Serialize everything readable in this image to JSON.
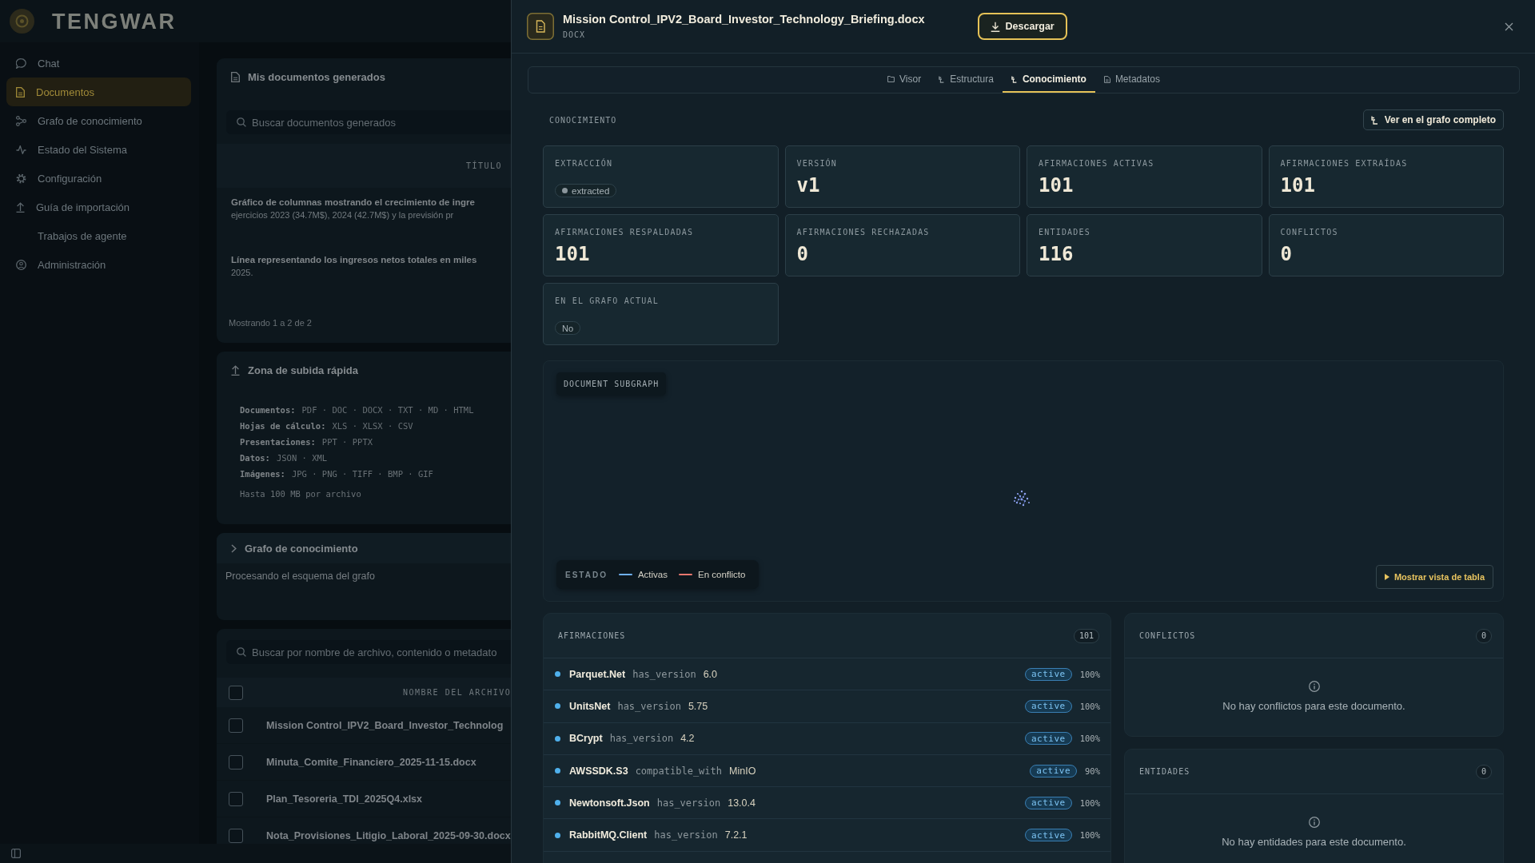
{
  "backdrop": {
    "logo": "TENGWAR",
    "nav": [
      {
        "label": "Chat",
        "selected": false
      },
      {
        "label": "Documentos",
        "selected": true
      },
      {
        "label": "Grafo de conocimiento",
        "selected": false
      },
      {
        "label": "Estado del Sistema",
        "selected": false
      },
      {
        "label": "Configuración",
        "selected": false
      },
      {
        "label": "Guía de importación",
        "selected": false
      },
      {
        "label": "Trabajos de agente",
        "selected": false
      },
      {
        "label": "Administración",
        "selected": false
      }
    ],
    "generated_documents": {
      "title": "Mis documentos generados",
      "search": {
        "placeholder": "Buscar documentos generados"
      },
      "column": "TÍTULO",
      "rows": [
        [
          "Gráfico de columnas mostrando el crecimiento de ingre",
          "ejercicios 2023 (34.7M$), 2024 (42.7M$) y la previsión pr"
        ],
        [
          "Línea representando los ingresos netos totales en miles",
          "2025."
        ]
      ],
      "footer": "Mostrando 1 a 2 de 2"
    },
    "upload_zone": {
      "title": "Zona de subida rápida",
      "formats": [
        {
          "label": "Documentos:",
          "values": "PDF · DOC · DOCX · TXT · MD · HTML"
        },
        {
          "label": "Hojas de cálculo:",
          "values": "XLS · XLSX · CSV"
        },
        {
          "label": "Presentaciones:",
          "values": "PPT · PPTX"
        },
        {
          "label": "Datos:",
          "values": "JSON · XML"
        },
        {
          "label": "Imágenes:",
          "values": "JPG · PNG · TIFF · BMP · GIF"
        }
      ],
      "limit": "Hasta 100 MB por archivo"
    },
    "knowledge_graph": {
      "title": "Grafo de conocimiento",
      "status": "Procesando el esquema del grafo"
    },
    "files": {
      "search": {
        "placeholder": "Buscar por nombre de archivo, contenido o metadato"
      },
      "select_all": {
        "checked": false
      },
      "column": "NOMBRE DEL ARCHIVO",
      "rows": [
        {
          "name": "Mission Control_IPV2_Board_Investor_Technolog",
          "checked": false
        },
        {
          "name": "Minuta_Comite_Financiero_2025-11-15.docx",
          "checked": false
        },
        {
          "name": "Plan_Tesoreria_TDI_2025Q4.xlsx",
          "checked": false
        },
        {
          "name": "Nota_Provisiones_Litigio_Laboral_2025-09-30.docx",
          "checked": false
        }
      ]
    }
  },
  "panel": {
    "file": {
      "name": "Mission Control_IPV2_Board_Investor_Technology_Briefing.docx",
      "type": "DOCX"
    },
    "download": "Descargar",
    "tabs": [
      {
        "label": "Visor",
        "selected": false
      },
      {
        "label": "Estructura",
        "selected": false
      },
      {
        "label": "Conocimiento",
        "selected": true
      },
      {
        "label": "Metadatos",
        "selected": false
      }
    ],
    "knowledge": {
      "title": "CONOCIMIENTO",
      "graph_button": "Ver en el grafo completo",
      "stats": [
        {
          "label": "EXTRACCIÓN",
          "kind": "badge",
          "value": "extracted"
        },
        {
          "label": "VERSIÓN",
          "kind": "number",
          "value": "v1"
        },
        {
          "label": "AFIRMACIONES ACTIVAS",
          "kind": "number",
          "value": "101"
        },
        {
          "label": "AFIRMACIONES EXTRAÍDAS",
          "kind": "number",
          "value": "101"
        },
        {
          "label": "AFIRMACIONES RESPALDADAS",
          "kind": "number",
          "value": "101"
        },
        {
          "label": "AFIRMACIONES RECHAZADAS",
          "kind": "number",
          "value": "0"
        },
        {
          "label": "ENTIDADES",
          "kind": "number",
          "value": "116"
        },
        {
          "label": "CONFLICTOS",
          "kind": "number",
          "value": "0"
        },
        {
          "label": "EN EL GRAFO ACTUAL",
          "kind": "pill",
          "value": "No"
        }
      ],
      "subgraph": {
        "title": "DOCUMENT SUBGRAPH",
        "legend": {
          "title": "ESTADO",
          "items": [
            {
              "label": "Activas",
              "color": "#6fb0f0"
            },
            {
              "label": "En conflicto",
              "color": "#e8776e"
            }
          ]
        },
        "table_button": "Mostrar vista de tabla"
      },
      "claims": {
        "title": "AFIRMACIONES",
        "count": "101",
        "rows": [
          {
            "subject": "Parquet.Net",
            "predicate": "has_version",
            "object": "6.0",
            "status": "active",
            "confidence": "100%"
          },
          {
            "subject": "UnitsNet",
            "predicate": "has_version",
            "object": "5.75",
            "status": "active",
            "confidence": "100%"
          },
          {
            "subject": "BCrypt",
            "predicate": "has_version",
            "object": "4.2",
            "status": "active",
            "confidence": "100%"
          },
          {
            "subject": "AWSSDK.S3",
            "predicate": "compatible_with",
            "object": "MinIO",
            "status": "active",
            "confidence": "90%"
          },
          {
            "subject": "Newtonsoft.Json",
            "predicate": "has_version",
            "object": "13.0.4",
            "status": "active",
            "confidence": "100%"
          },
          {
            "subject": "RabbitMQ.Client",
            "predicate": "has_version",
            "object": "7.2.1",
            "status": "active",
            "confidence": "100%"
          }
        ]
      },
      "conflicts": {
        "title": "CONFLICTOS",
        "count": "0",
        "empty": "No hay conflictos para este documento."
      },
      "entities": {
        "title": "ENTIDADES",
        "count": "0",
        "empty": "No hay entidades para este documento."
      }
    }
  }
}
